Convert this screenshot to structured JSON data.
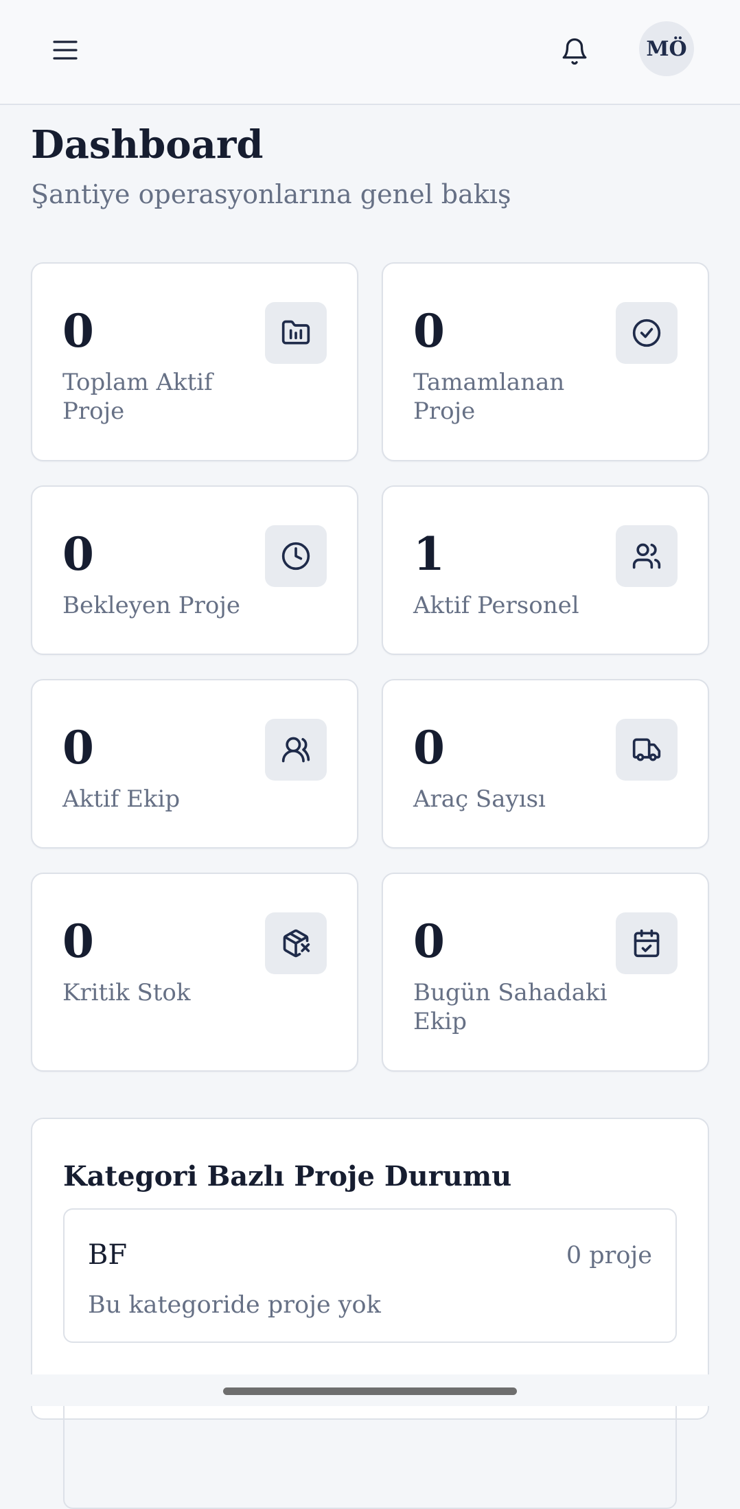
{
  "header": {
    "menu_icon": "menu-icon",
    "notification_icon": "bell-icon",
    "avatar_initials": "MÖ"
  },
  "page": {
    "title": "Dashboard",
    "subtitle": "Şantiye operasyonlarına genel bakış"
  },
  "stats": [
    {
      "value": "0",
      "label": "Toplam Aktif Proje",
      "icon": "folder-chart-icon"
    },
    {
      "value": "0",
      "label": "Tamamlanan Proje",
      "icon": "check-circle-icon"
    },
    {
      "value": "0",
      "label": "Bekleyen Proje",
      "icon": "clock-icon"
    },
    {
      "value": "1",
      "label": "Aktif Personel",
      "icon": "users-icon"
    },
    {
      "value": "0",
      "label": "Aktif Ekip",
      "icon": "team-icon"
    },
    {
      "value": "0",
      "label": "Araç Sayısı",
      "icon": "truck-icon"
    },
    {
      "value": "0",
      "label": "Kritik Stok",
      "icon": "package-x-icon"
    },
    {
      "value": "0",
      "label": "Bugün Sahadaki Ekip",
      "icon": "calendar-check-icon"
    }
  ],
  "category_section": {
    "title": "Kategori Bazlı Proje Durumu",
    "items": [
      {
        "name": "BF",
        "count": "0 proje",
        "empty_text": "Bu kategoride proje yok"
      }
    ]
  },
  "colors": {
    "background": "#f4f6f9",
    "card": "#ffffff",
    "border": "#dde1e8",
    "icon_tile": "#e8ebf0",
    "icon_stroke": "#1f2b4a",
    "text_primary": "#161d30",
    "text_secondary": "#667085"
  }
}
